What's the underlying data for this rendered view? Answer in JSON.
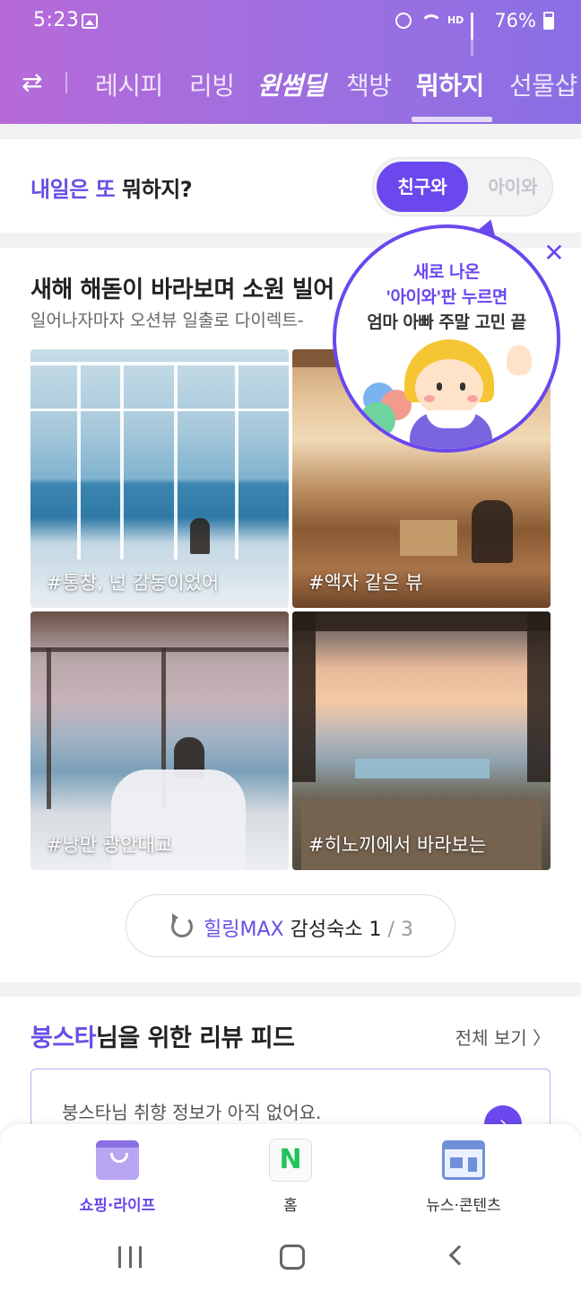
{
  "status_bar": {
    "time": "5:23",
    "hd": "HD",
    "battery": "76%"
  },
  "tabs": {
    "items": [
      "레시피",
      "리빙",
      "윈썸딜",
      "책방",
      "뭐하지",
      "선물샵"
    ],
    "active": "뭐하지"
  },
  "question": {
    "prefix": "내일은 또",
    "suffix": " 뭐하지?",
    "toggle_on": "친구와",
    "toggle_off": "아이와"
  },
  "section": {
    "title": "새해 해돋이 바라보며 소원 빌어",
    "subtitle": "일어나자마자 오션뷰 일출로 다이렉트-",
    "photos": [
      {
        "caption": "#통창, 넌 감동이었어"
      },
      {
        "caption": "#액자 같은 뷰"
      },
      {
        "caption": "#낭만 광안대교"
      },
      {
        "caption": "#히노끼에서 바라보는"
      }
    ],
    "pager": {
      "accent": "힐링MAX",
      "label": " 감성숙소 ",
      "current": "1",
      "total": " / 3"
    }
  },
  "promo_bubble": {
    "line1": "새로 나온",
    "line2": "'아이와'판 누르면",
    "line3": "엄마 아빠 주말 고민 끝",
    "close_label": "✕"
  },
  "review_feed": {
    "user": "붕스타",
    "title_rest": "님을 위한 리뷰 피드",
    "more_label": "전체 보기 〉",
    "empty_text": "붕스타님 취향 정보가 아직 없어요.",
    "go_icon": "›"
  },
  "bottom_nav": {
    "items": [
      "쇼핑·라이프",
      "홈",
      "뉴스·콘텐츠"
    ],
    "active": "쇼핑·라이프",
    "home_glyph": "N"
  },
  "colors": {
    "accent": "#6a48ee",
    "header_start": "#b66ad8",
    "header_end": "#8a6fe4"
  }
}
